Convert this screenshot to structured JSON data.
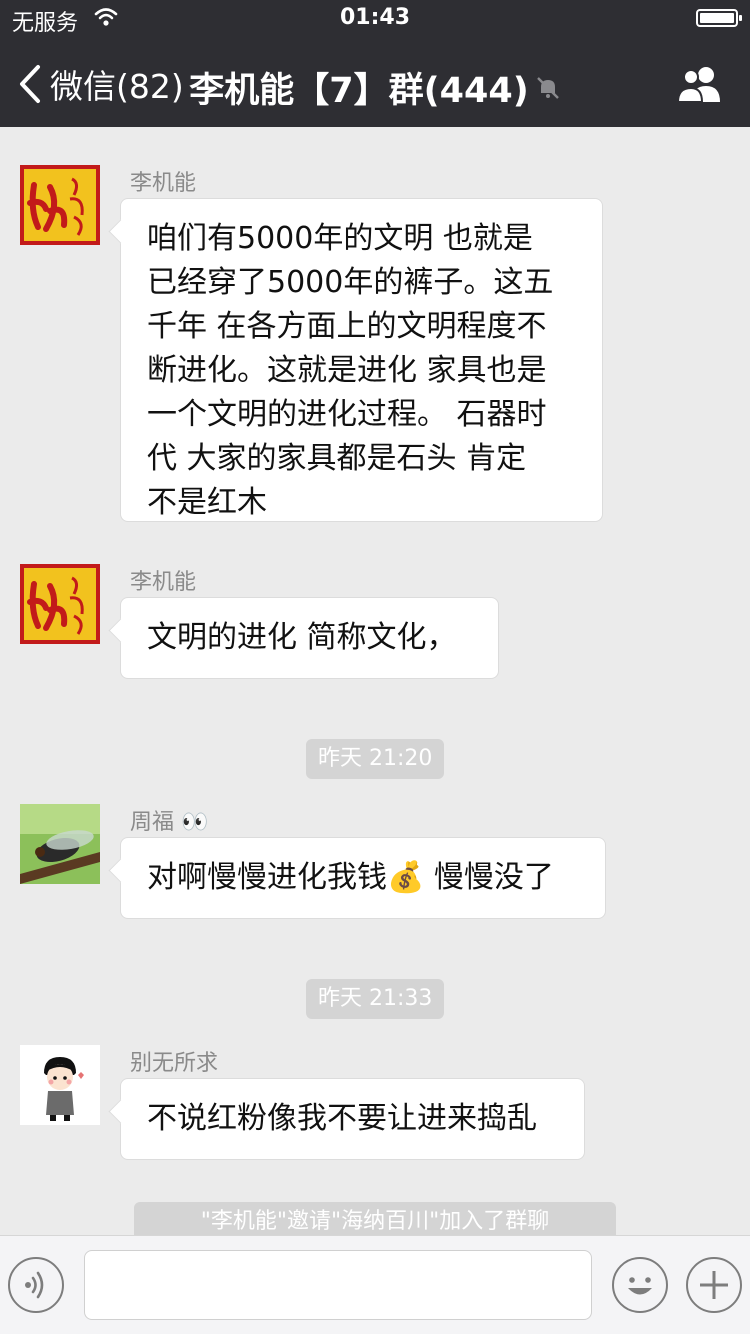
{
  "status_bar": {
    "carrier": "无服务",
    "time": "01:43"
  },
  "navbar": {
    "back_label": "微信(82)",
    "title": "李机能【7】群(444)"
  },
  "messages": [
    {
      "sender": "李机能",
      "text_lines": [
        "咱们有5000年的文明 也就是",
        "已经穿了5000年的裤子。这五",
        "千年 在各方面上的文明程度不",
        "断进化。这就是进化  家具也是",
        "一个文明的进化过程。 石器时",
        "代  大家的家具都是石头  肯定",
        "不是红木"
      ]
    },
    {
      "sender": "李机能",
      "text": "文明的进化 简称文化，"
    },
    {
      "timestamp": "昨天 21:20"
    },
    {
      "sender": "周福 👀",
      "text_before": "对啊慢慢进化我钱",
      "emoji": "💰",
      "text_after": " 慢慢没了"
    },
    {
      "timestamp": "昨天 21:33"
    },
    {
      "sender": "别无所求",
      "text": "不说红粉像我不要让进来捣乱"
    }
  ],
  "system_message": "\"李机能\"邀请\"海纳百川\"加入了群聊",
  "icons": [
    "wifi-icon",
    "battery-icon",
    "back-chevron-icon",
    "mute-bell-icon",
    "group-members-icon",
    "voice-icon",
    "emoji-icon",
    "plus-icon",
    "avatar-red-calligraphy",
    "avatar-cicada",
    "avatar-cartoon-girl"
  ]
}
